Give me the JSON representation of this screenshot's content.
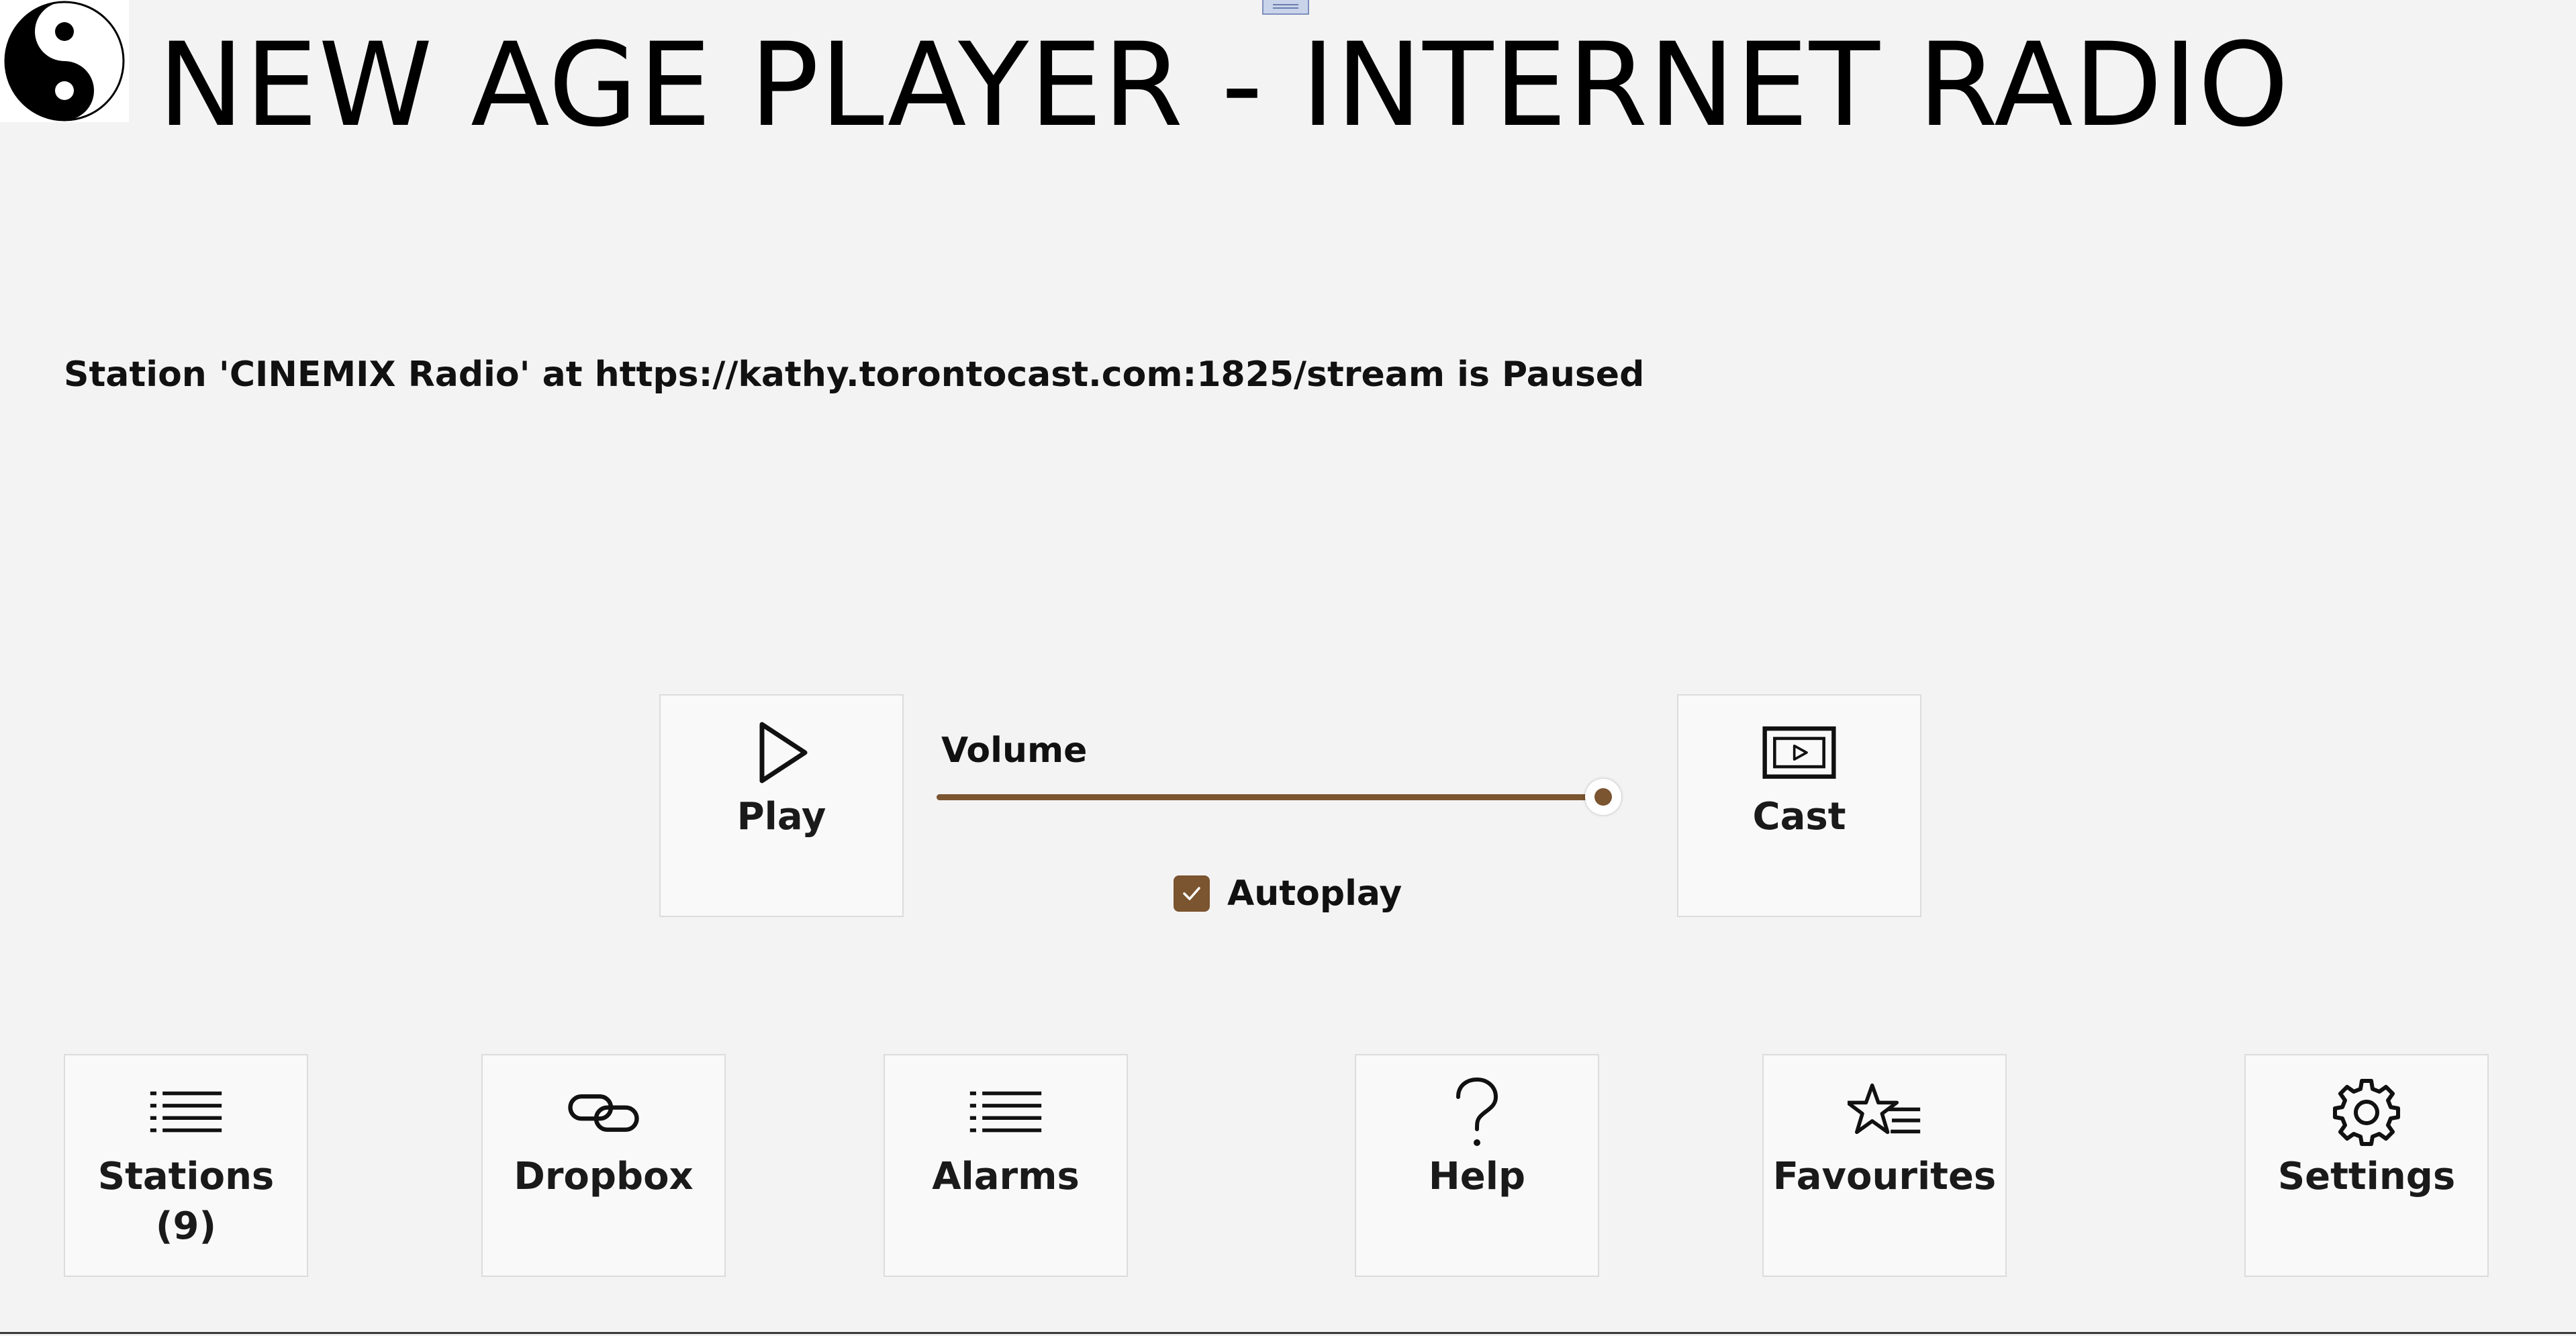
{
  "header": {
    "title": "NEW AGE PLAYER - INTERNET RADIO",
    "logo_icon": "yin-yang-icon"
  },
  "status": {
    "text": "Station 'CINEMIX Radio' at https://kathy.torontocast.com:1825/stream is Paused"
  },
  "controls": {
    "play": {
      "label": "Play",
      "icon": "play-icon"
    },
    "volume": {
      "label": "Volume",
      "level_percent": 100
    },
    "autoplay": {
      "label": "Autoplay",
      "checked": true
    },
    "cast": {
      "label": "Cast",
      "icon": "cast-icon"
    }
  },
  "nav": {
    "stations": {
      "label": "Stations",
      "count": "(9)",
      "icon": "list-icon"
    },
    "dropbox": {
      "label": "Dropbox",
      "icon": "link-icon"
    },
    "alarms": {
      "label": "Alarms",
      "icon": "list-icon"
    },
    "help": {
      "label": "Help",
      "icon": "question-icon"
    },
    "favourites": {
      "label": "Favourites",
      "icon": "star-list-icon"
    },
    "settings": {
      "label": "Settings",
      "icon": "gear-icon"
    }
  },
  "colors": {
    "background": "#f3f3f3",
    "tile": "#f9f9f9",
    "accent": "#7b5430",
    "text": "#111111"
  }
}
